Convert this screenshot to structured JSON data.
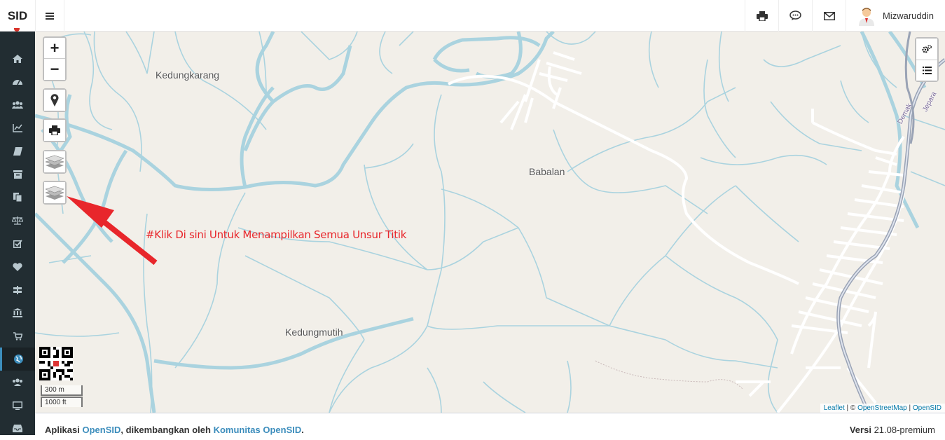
{
  "brand": "SID",
  "user": {
    "name": "Mizwaruddin"
  },
  "sidebar": {
    "items": [
      "home-icon",
      "dashboard-icon",
      "users-icon",
      "chart-icon",
      "book-icon",
      "archive-icon",
      "files-icon",
      "balance-icon",
      "checkbox-icon",
      "heart-icon",
      "signpost-icon",
      "bank-icon",
      "cart-icon",
      "globe-icon",
      "group-icon",
      "monitor-icon",
      "inbox-icon"
    ],
    "active": "globe-icon"
  },
  "map": {
    "places": [
      "Kedungkarang",
      "Babalan",
      "Kedungmutih"
    ],
    "road_labels": [
      "Demak",
      "Jepara"
    ],
    "zoom_in": "+",
    "zoom_out": "−",
    "annotation": "#Klik Di sini Untuk Menampilkan  Semua  Unsur  Titik",
    "scale_metric": "300 m",
    "scale_imperial": "1000 ft",
    "attribution": {
      "leaflet": "Leaflet",
      "sep1": " | © ",
      "osm": "OpenStreetMap",
      "sep2": " | ",
      "opensid": "OpenSID"
    }
  },
  "footer": {
    "prefix": "Aplikasi ",
    "app": "OpenSID",
    "middle": ", dikembangkan oleh ",
    "community": "Komunitas OpenSID",
    "suffix": ".",
    "version_label": "Versi",
    "version": "21.08-premium"
  },
  "colors": {
    "sidebar": "#222d32",
    "accent": "#3c8dbc",
    "annotation": "#e8262b",
    "map_bg": "#f2efe9",
    "water": "#aad3df"
  }
}
